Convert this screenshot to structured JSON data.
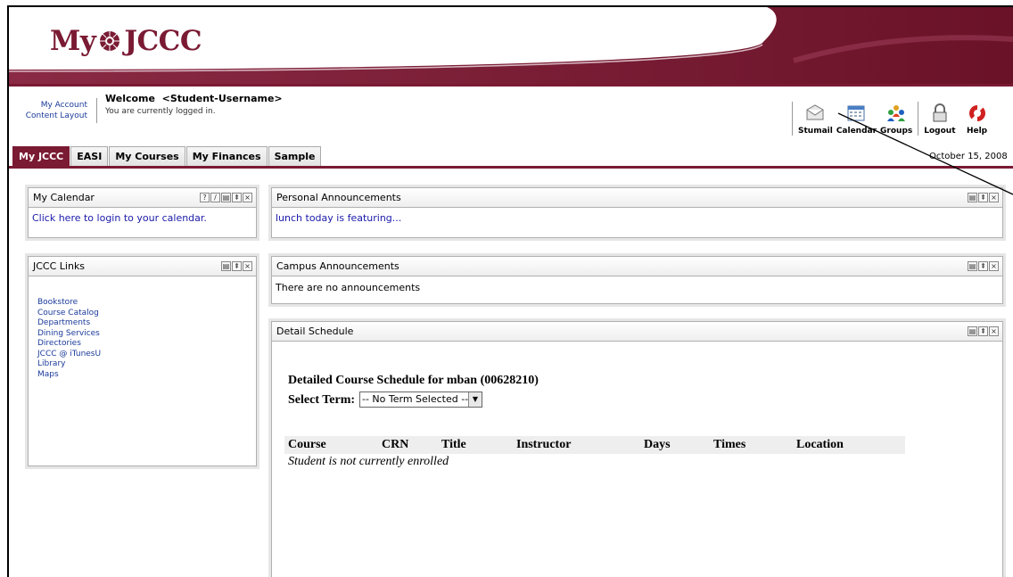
{
  "brand": {
    "logo_left": "My",
    "logo_right": "JCCC",
    "maroon": "#7a1a33"
  },
  "account": {
    "my_account": "My Account",
    "content_layout": "Content Layout"
  },
  "welcome": {
    "label": "Welcome",
    "username": "<Student-Username>",
    "status": "You are currently logged in."
  },
  "tools": [
    {
      "label": "Stumail",
      "icon": "mail-icon"
    },
    {
      "label": "Calendar",
      "icon": "calendar-icon"
    },
    {
      "label": "Groups",
      "icon": "groups-icon"
    },
    {
      "label": "Logout",
      "icon": "lock-icon"
    },
    {
      "label": "Help",
      "icon": "lifebuoy-icon"
    }
  ],
  "date": "October 15, 2008",
  "tabs": [
    {
      "label": "My JCCC",
      "active": true
    },
    {
      "label": "EASI"
    },
    {
      "label": "My Courses"
    },
    {
      "label": "My Finances"
    },
    {
      "label": "Sample"
    }
  ],
  "calendar": {
    "title": "My Calendar",
    "link": "Click here to login to your calendar."
  },
  "links": {
    "title": "JCCC Links",
    "items": [
      "Bookstore",
      "Course Catalog",
      "Departments",
      "Dining Services",
      "Directories",
      "JCCC @ iTunesU",
      "Library",
      "Maps"
    ]
  },
  "personal": {
    "title": "Personal Announcements",
    "link": "lunch today is featuring..."
  },
  "campus": {
    "title": "Campus Announcements",
    "text": "There are no announcements"
  },
  "schedule": {
    "title": "Detail Schedule",
    "heading": "Detailed Course Schedule for mban (00628210)",
    "term_label": "Select Term:",
    "term_value": "-- No Term Selected --",
    "columns": [
      "Course",
      "CRN",
      "Title",
      "Instructor",
      "Days",
      "Times",
      "Location"
    ],
    "empty": "Student is not currently enrolled"
  }
}
